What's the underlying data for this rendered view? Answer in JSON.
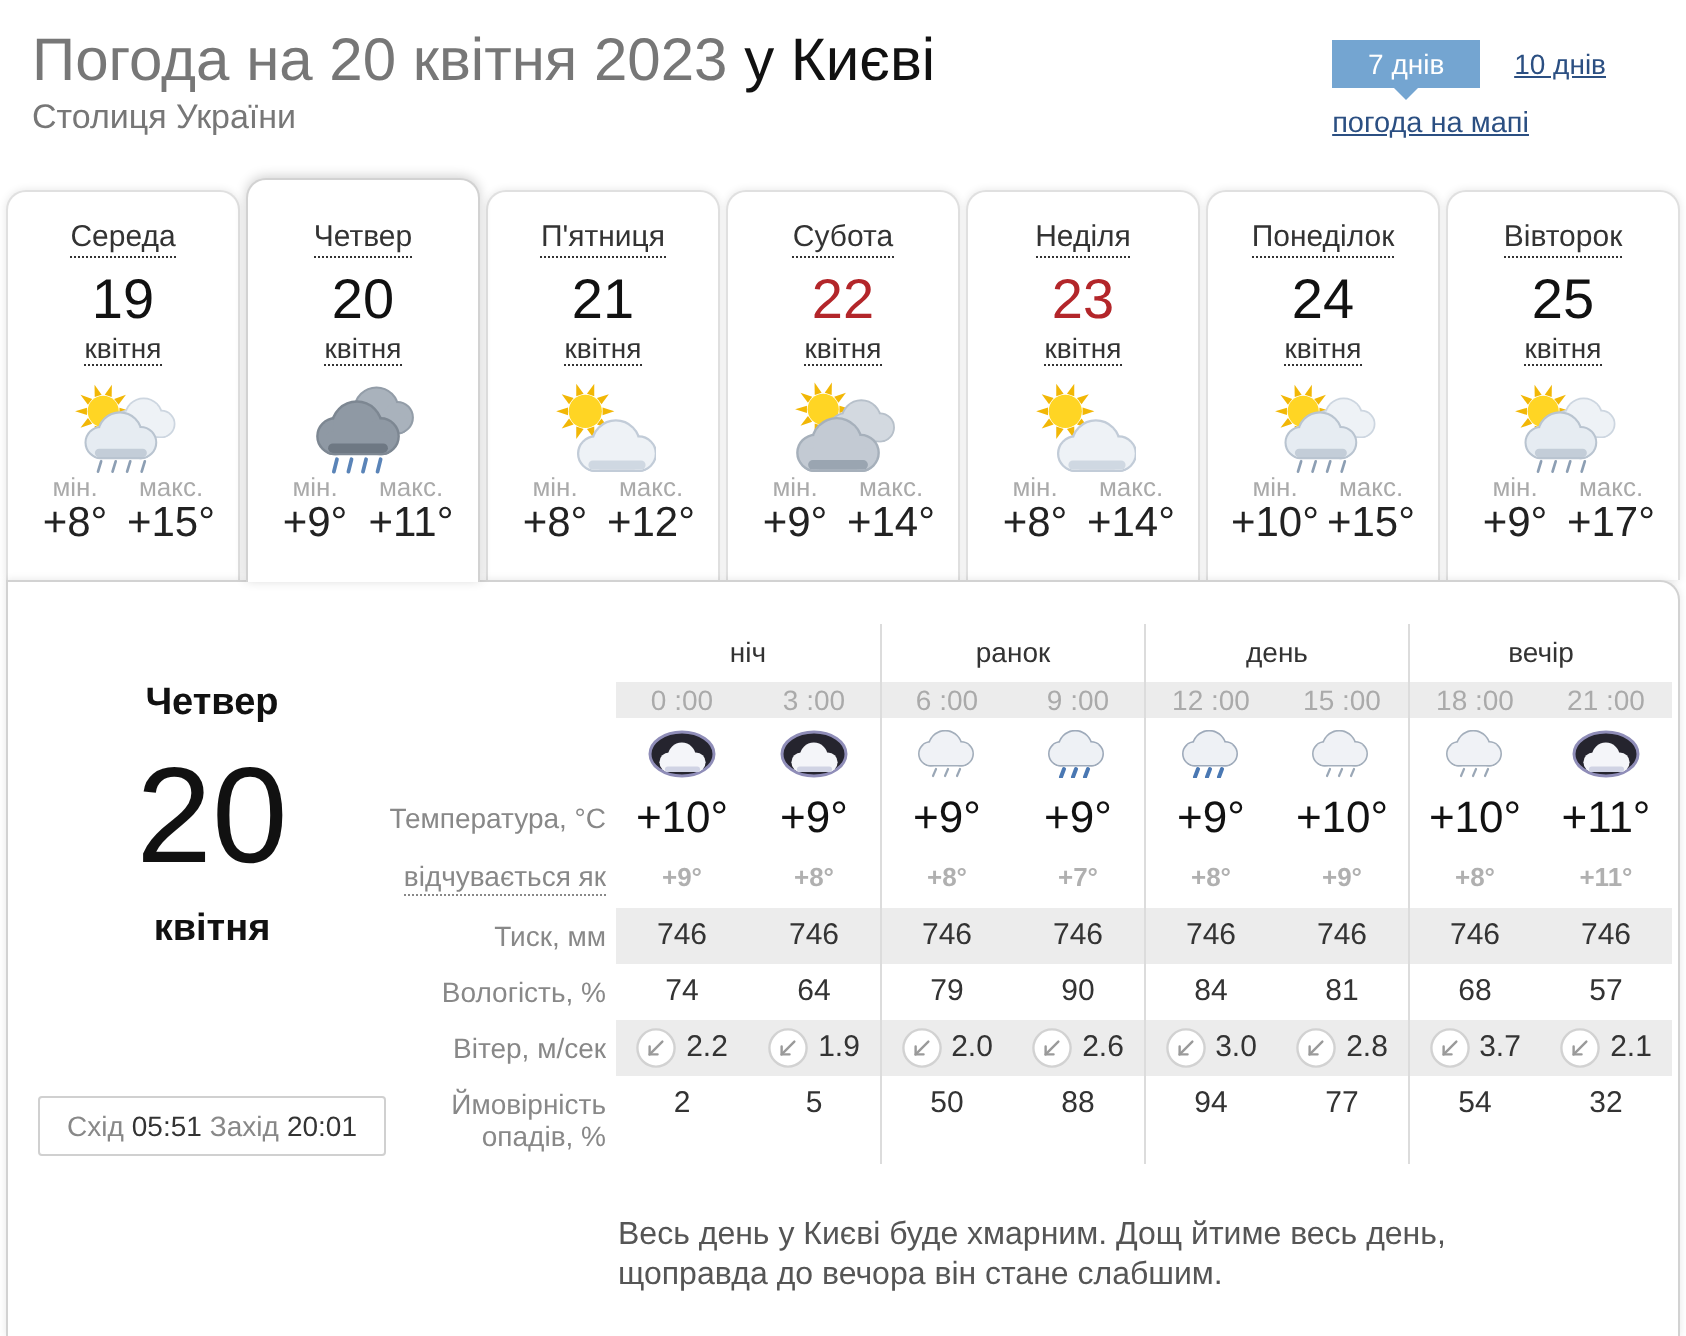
{
  "header": {
    "title": "Погода на 20 квітня 2023",
    "city": "у Києві",
    "subtitle": "Столиця України"
  },
  "ranges": [
    {
      "label": "7 днів",
      "selected": true
    },
    {
      "label": "10 днів",
      "selected": false
    }
  ],
  "map_link": "погода на мапі",
  "days": [
    {
      "weekday": "Середа",
      "date": "19",
      "month": "квітня",
      "kind": "sun_cloud_rain",
      "min_label": "мін.",
      "min": "+8°",
      "max_label": "макс.",
      "max": "+15°",
      "weekend": false,
      "selected": false
    },
    {
      "weekday": "Четвер",
      "date": "20",
      "month": "квітня",
      "kind": "rain_clouds",
      "min_label": "мін.",
      "min": "+9°",
      "max_label": "макс.",
      "max": "+11°",
      "weekend": false,
      "selected": true
    },
    {
      "weekday": "П'ятниця",
      "date": "21",
      "month": "квітня",
      "kind": "sun_cloud",
      "min_label": "мін.",
      "min": "+8°",
      "max_label": "макс.",
      "max": "+12°",
      "weekend": false,
      "selected": false
    },
    {
      "weekday": "Субота",
      "date": "22",
      "month": "квітня",
      "kind": "sun_clouds",
      "min_label": "мін.",
      "min": "+9°",
      "max_label": "макс.",
      "max": "+14°",
      "weekend": true,
      "selected": false
    },
    {
      "weekday": "Неділя",
      "date": "23",
      "month": "квітня",
      "kind": "sun_cloud",
      "min_label": "мін.",
      "min": "+8°",
      "max_label": "макс.",
      "max": "+14°",
      "weekend": true,
      "selected": false
    },
    {
      "weekday": "Понеділок",
      "date": "24",
      "month": "квітня",
      "kind": "sun_cloud_rain",
      "min_label": "мін.",
      "min": "+10°",
      "max_label": "макс.",
      "max": "+15°",
      "weekend": false,
      "selected": false
    },
    {
      "weekday": "Вівторок",
      "date": "25",
      "month": "квітня",
      "kind": "sun_cloud_rain",
      "min_label": "мін.",
      "min": "+9°",
      "max_label": "макс.",
      "max": "+17°",
      "weekend": false,
      "selected": false
    }
  ],
  "detail": {
    "weekday": "Четвер",
    "date": "20",
    "month": "квітня",
    "sunrise_label": "Схід",
    "sunrise": "05:51",
    "sunset_label": "Захід",
    "sunset": "20:01",
    "periods": [
      "ніч",
      "ранок",
      "день",
      "вечір"
    ],
    "hours": [
      {
        "time": "0 :00",
        "kind": "night_cloudy"
      },
      {
        "time": "3 :00",
        "kind": "night_cloudy"
      },
      {
        "time": "6 :00",
        "kind": "light_rain"
      },
      {
        "time": "9 :00",
        "kind": "rain"
      },
      {
        "time": "12 :00",
        "kind": "rain"
      },
      {
        "time": "15 :00",
        "kind": "light_rain"
      },
      {
        "time": "18 :00",
        "kind": "light_rain"
      },
      {
        "time": "21 :00",
        "kind": "night_cloudy"
      }
    ],
    "temperature": {
      "label": "Температура, °C",
      "values": [
        "+10°",
        "+9°",
        "+9°",
        "+9°",
        "+9°",
        "+10°",
        "+10°",
        "+11°"
      ]
    },
    "feels_like": {
      "label": "відчувається як",
      "values": [
        "+9°",
        "+8°",
        "+8°",
        "+7°",
        "+8°",
        "+9°",
        "+8°",
        "+11°"
      ]
    },
    "stats": [
      {
        "kind": "plain",
        "label": "Тиск, мм",
        "values": [
          "746",
          "746",
          "746",
          "746",
          "746",
          "746",
          "746",
          "746"
        ]
      },
      {
        "kind": "plain",
        "label": "Вологість, %",
        "values": [
          "74",
          "64",
          "79",
          "90",
          "84",
          "81",
          "68",
          "57"
        ]
      },
      {
        "kind": "wind",
        "label": "Вітер, м/сек",
        "values": [
          "2.2",
          "1.9",
          "2.0",
          "2.6",
          "3.0",
          "2.8",
          "3.7",
          "2.1"
        ]
      },
      {
        "kind": "plain",
        "label": "Ймовірність опадів, %",
        "values": [
          "2",
          "5",
          "50",
          "88",
          "94",
          "77",
          "54",
          "32"
        ]
      }
    ]
  },
  "description": "Весь день у Києві буде хмарним. Дощ йтиме весь день, щоправда до вечора він стане слабшим."
}
